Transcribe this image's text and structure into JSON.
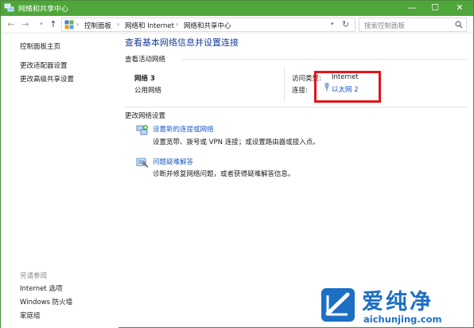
{
  "window": {
    "title": "网络和共享中心",
    "controls": {
      "minimize": "—",
      "maximize": "☐",
      "close": "✕"
    }
  },
  "addressbar": {
    "breadcrumbs": [
      "控制面板",
      "网络和 Internet",
      "网络和共享中心"
    ],
    "separator": "›",
    "search_placeholder": "搜索控制面板"
  },
  "leftpane": {
    "items": [
      "控制面板主页",
      "更改适配器设置",
      "更改高级共享设置"
    ],
    "see_also_header": "另请参阅",
    "see_also_items": [
      "Internet 选项",
      "Windows 防火墙",
      "家庭组"
    ]
  },
  "main": {
    "title": "查看基本网络信息并设置连接",
    "active_networks_header": "查看活动网络",
    "network": {
      "name": "网络  3",
      "type": "公用网络",
      "access_type_label": "访问类型:",
      "access_type_value": "Internet",
      "connections_label": "连接:",
      "connection_name": "以太网 2"
    },
    "change_settings_header": "更改网络设置",
    "tasks": [
      {
        "link": "设置新的连接或网络",
        "desc": "设置宽带、拨号或 VPN 连接；或设置路由器或接入点。",
        "icon": "network-setup-icon"
      },
      {
        "link": "问题疑难解答",
        "desc": "诊断并修复网络问题，或者获得疑难解答信息。",
        "icon": "troubleshoot-icon"
      }
    ]
  },
  "watermark": {
    "text": "爱纯净",
    "url": "aichunjing.com"
  },
  "colors": {
    "titlebar": "#4fa63a",
    "link": "#1a5bc4",
    "title_blue": "#1a3e9a",
    "highlight": "#e4121c",
    "watermark": "#1d6fc4"
  }
}
